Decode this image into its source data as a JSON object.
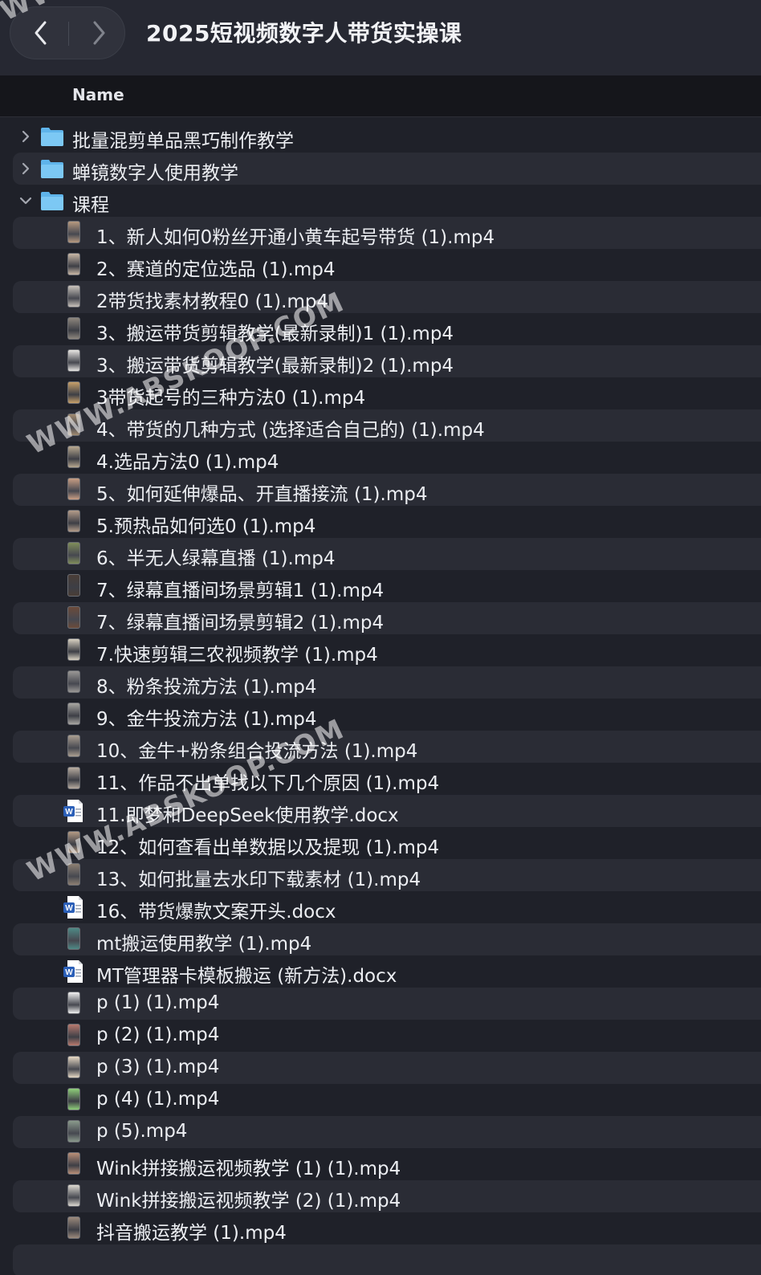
{
  "window": {
    "title": "2025短视频数字人带货实操课"
  },
  "columns": {
    "name": "Name"
  },
  "folders": [
    {
      "label": "批量混剪单品黑巧制作教学",
      "expanded": false
    },
    {
      "label": "蝉镜数字人使用教学",
      "expanded": false
    },
    {
      "label": "课程",
      "expanded": true
    }
  ],
  "files": [
    {
      "label": "1、新人如何0粉丝开通小黄车起号带货 (1).mp4",
      "kind": "video",
      "thumb": "#b79a80"
    },
    {
      "label": "2、赛道的定位选品 (1).mp4",
      "kind": "video",
      "thumb": "#c9b8a6"
    },
    {
      "label": "2带货找素材教程0 (1).mp4",
      "kind": "video",
      "thumb": "#c8c2bb"
    },
    {
      "label": "3、搬运带货剪辑教学(最新录制)1 (1).mp4",
      "kind": "video",
      "thumb": "#8e877e"
    },
    {
      "label": "3、搬运带货剪辑教学(最新录制)2 (1).mp4",
      "kind": "video",
      "thumb": "#e8e6e3"
    },
    {
      "label": "3带货起号的三种方法0 (1).mp4",
      "kind": "video",
      "thumb": "#c7a06a"
    },
    {
      "label": "4、带货的几种方式 (选择适合自己的) (1).mp4",
      "kind": "video",
      "thumb": "#a08a70"
    },
    {
      "label": "4.选品方法0 (1).mp4",
      "kind": "video",
      "thumb": "#b8a890"
    },
    {
      "label": "5、如何延伸爆品、开直播接流 (1).mp4",
      "kind": "video",
      "thumb": "#c99e84"
    },
    {
      "label": "5.预热品如何选0 (1).mp4",
      "kind": "video",
      "thumb": "#b49c8a"
    },
    {
      "label": "6、半无人绿幕直播 (1).mp4",
      "kind": "video",
      "thumb": "#7f8d5a"
    },
    {
      "label": "7、绿幕直播间场景剪辑1 (1).mp4",
      "kind": "video",
      "thumb": "#4a3d36"
    },
    {
      "label": "7、绿幕直播间场景剪辑2 (1).mp4",
      "kind": "video",
      "thumb": "#6c4b3a"
    },
    {
      "label": "7.快速剪辑三农视频教学 (1).mp4",
      "kind": "video",
      "thumb": "#d8d1c2"
    },
    {
      "label": "8、粉条投流方法 (1).mp4",
      "kind": "video",
      "thumb": "#9a9896"
    },
    {
      "label": "9、金牛投流方法 (1).mp4",
      "kind": "video",
      "thumb": "#a8a6a2"
    },
    {
      "label": "10、金牛+粉条组合投流方法 (1).mp4",
      "kind": "video",
      "thumb": "#aa9e90"
    },
    {
      "label": "11、作品不出单找以下几个原因 (1).mp4",
      "kind": "video",
      "thumb": "#b8aca0"
    },
    {
      "label": "11.即梦和DeepSeek使用教学.docx",
      "kind": "doc",
      "thumb": "#2b5fb8"
    },
    {
      "label": "12、如何查看出单数据以及提现 (1).mp4",
      "kind": "video",
      "thumb": "#b39a84"
    },
    {
      "label": "13、如何批量去水印下载素材 (1).mp4",
      "kind": "video",
      "thumb": "#8d7f72"
    },
    {
      "label": "16、带货爆款文案开头.docx",
      "kind": "doc",
      "thumb": "#2b5fb8"
    },
    {
      "label": "mt搬运使用教学 (1).mp4",
      "kind": "video",
      "thumb": "#4e8a86"
    },
    {
      "label": "MT管理器卡模板搬运 (新方法).docx",
      "kind": "doc",
      "thumb": "#2b5fb8"
    },
    {
      "label": "p (1) (1).mp4",
      "kind": "video",
      "thumb": "#f1f1f1"
    },
    {
      "label": "p (2) (1).mp4",
      "kind": "video",
      "thumb": "#b7796e"
    },
    {
      "label": "p (3) (1).mp4",
      "kind": "video",
      "thumb": "#e6d8c4"
    },
    {
      "label": "p (4) (1).mp4",
      "kind": "video",
      "thumb": "#8fcf7a"
    },
    {
      "label": "p (5).mp4",
      "kind": "video",
      "thumb": "#8a9a8c"
    },
    {
      "label": "Wink拼接搬运视频教学 (1) (1).mp4",
      "kind": "video",
      "thumb": "#b98f78"
    },
    {
      "label": "Wink拼接搬运视频教学 (2) (1).mp4",
      "kind": "video",
      "thumb": "#dcd8d0"
    },
    {
      "label": "抖音搬运教学 (1).mp4",
      "kind": "video",
      "thumb": "#9c8a7c"
    }
  ],
  "watermark": {
    "text": "WWW.ABSKOOP.COM"
  },
  "colors": {
    "background": "#1f2129",
    "stripe": "#2a2c35",
    "folder": "#5fb4ea",
    "text": "#eceef2"
  }
}
